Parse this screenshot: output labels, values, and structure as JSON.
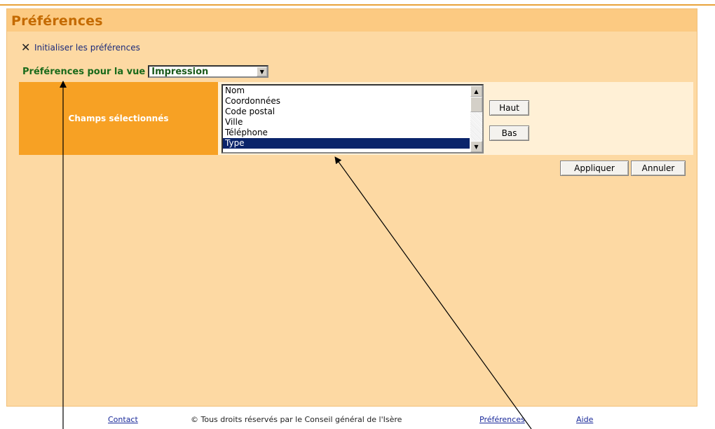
{
  "panel": {
    "title": "Préférences",
    "reset_link": "Initialiser les préférences",
    "reset_icon": "close-icon"
  },
  "view": {
    "label": "Préférences pour la vue",
    "selected": "Impression"
  },
  "fields": {
    "label": "Champs sélectionnés",
    "items": [
      "Nom",
      "Coordonnées",
      "Code postal",
      "Ville",
      "Téléphone",
      "Type"
    ],
    "selected_index": 5,
    "up_label": "Haut",
    "down_label": "Bas"
  },
  "actions": {
    "apply_label": "Appliquer",
    "cancel_label": "Annuler"
  },
  "footer": {
    "contact": "Contact",
    "copyright": "© Tous droits réservés par le Conseil général de l'Isère",
    "preferences": "Préférences",
    "help": "Aide"
  },
  "colors": {
    "panel_bg": "#fdd9a3",
    "header_bg": "#fcca82",
    "title": "#c46a00",
    "label_box": "#f7a124",
    "selection": "#0a246a"
  }
}
